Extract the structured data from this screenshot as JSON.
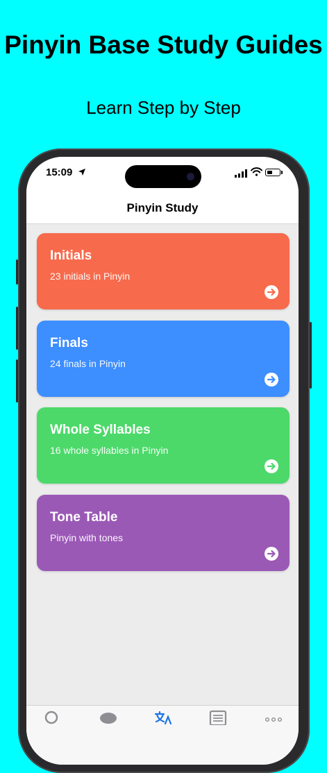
{
  "promo": {
    "headline": "Pinyin Base Study Guides",
    "subhead": "Learn Step by Step"
  },
  "status": {
    "time": "15:09"
  },
  "nav": {
    "title": "Pinyin Study"
  },
  "cards": [
    {
      "title": "Initials",
      "subtitle": "23 initials in Pinyin",
      "color": "#F76A4C"
    },
    {
      "title": "Finals",
      "subtitle": "24 finals in Pinyin",
      "color": "#3D8EFF"
    },
    {
      "title": "Whole Syllables",
      "subtitle": "16 whole syllables in Pinyin",
      "color": "#4CD96A"
    },
    {
      "title": "Tone Table",
      "subtitle": "Pinyin with tones",
      "color": "#9B59B6"
    }
  ],
  "colors": {
    "background": "#00FFFF",
    "tab_active": "#1A73E8",
    "tab_inactive": "#8E8E93"
  },
  "icons": {
    "card_action": "arrow-right-circle-icon",
    "tabs": [
      "search-icon",
      "chat-bubble-icon",
      "translate-icon",
      "book-icon",
      "more-icon"
    ]
  }
}
